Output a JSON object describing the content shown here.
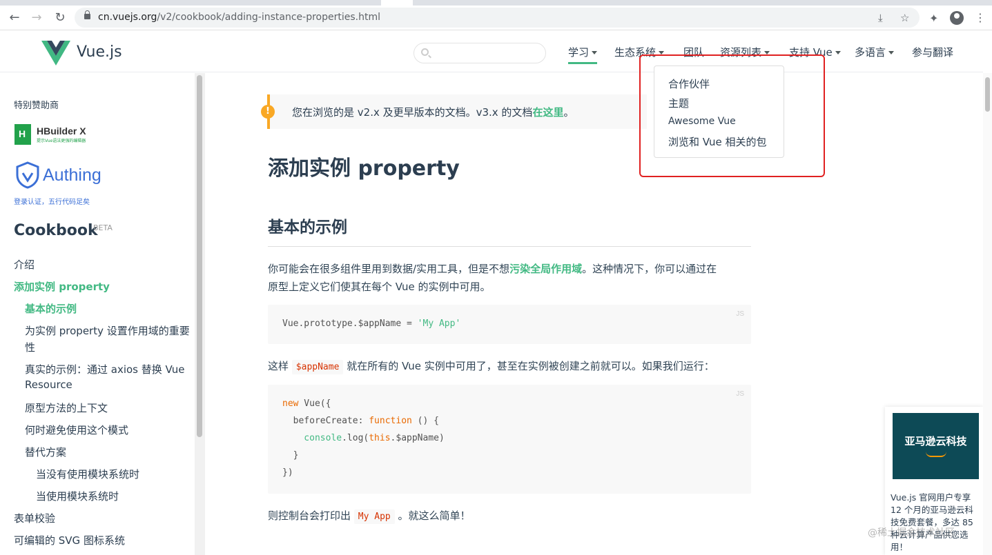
{
  "browser": {
    "url_domain": "cn.vuejs.org",
    "url_path": "/v2/cookbook/adding-instance-properties.html"
  },
  "header": {
    "brand": "Vue.js",
    "search_placeholder": "",
    "nav": [
      {
        "label": "学习",
        "current": true
      },
      {
        "label": "生态系统"
      },
      {
        "label": "团队"
      },
      {
        "label": "资源列表"
      },
      {
        "label": "支持 Vue"
      },
      {
        "label": "多语言"
      },
      {
        "label": "参与翻译"
      }
    ]
  },
  "dropdown": {
    "items": [
      "合作伙伴",
      "主题",
      "Awesome Vue",
      "浏览和 Vue 相关的包"
    ]
  },
  "sidebar": {
    "sponsor_label": "特别赞助商",
    "sponsors": [
      {
        "name": "HBuilder X",
        "tagline": "提示Vue语法更强的编辑器"
      },
      {
        "name": "Authing",
        "tagline": "登录认证，五行代码足矣"
      }
    ],
    "section_title": "Cookbook",
    "section_badge": "BETA",
    "items": [
      "介绍",
      "添加实例 property",
      "基本的示例",
      "为实例 property 设置作用域的重要",
      "性",
      "真实的示例：通过 axios 替换 Vue",
      "Resource",
      "原型方法的上下文",
      "何时避免使用这个模式",
      "替代方案",
      "当没有使用模块系统时",
      "当使用模块系统时",
      "表单校验",
      "可编辑的 SVG 图标系统"
    ]
  },
  "content": {
    "tip_text": "您在浏览的是 v2.x 及更早版本的文档。v3.x 的文档",
    "tip_link": "在这里",
    "tip_end": "。",
    "title": "添加实例 property",
    "section": "基本的示例",
    "p1_a": "你可能会在很多组件里用到数据/实用工具，但是不想",
    "p1_link": "污染全局作用域",
    "p1_b": "。这种情况下，你可以通过在",
    "p1_c": "原型上定义它们使其在每个 Vue 的实例中可用。",
    "code1_lang": "JS",
    "code1_a": "Vue.prototype.$appName = ",
    "code1_b": "'My App'",
    "p2_a": "这样",
    "p2_code": "$appName",
    "p2_b": "就在所有的 Vue 实例中可用了，甚至在实例被创建之前就可以。如果我们运行：",
    "code2_lang": "JS",
    "code2": {
      "l1_kw": "new",
      "l1": " Vue({",
      "l2_a": "  beforeCreate: ",
      "l2_kw": "function",
      "l2_b": " () {",
      "l3_fn": "    console",
      "l3_a": ".log(",
      "l3_kw": "this",
      "l3_b": ".$appName)",
      "l4": "  }",
      "l5": "})"
    },
    "p3_a": "则控制台会打印出",
    "p3_code": "My App",
    "p3_b": "。就这么简单！"
  },
  "ad": {
    "image_text": "亚马逊云科技",
    "text": "Vue.js 官网用户专享 12 个月的亚马逊云科技免费套餐，多达 85 种云计算产品供您选用！"
  },
  "watermark": "@稀土掘金技术社区"
}
